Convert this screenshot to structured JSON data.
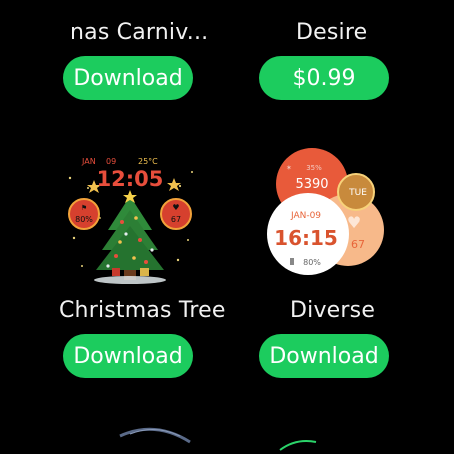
{
  "items": [
    {
      "title": "nas Carniv...",
      "button": "Download"
    },
    {
      "title": "Desire",
      "button": "$0.99"
    },
    {
      "title": "Christmas Tree",
      "button": "Download"
    },
    {
      "title": "Diverse",
      "button": "Download"
    }
  ],
  "xmas_face": {
    "month": "JAN",
    "day": "09",
    "temp": "25°C",
    "time": "12:05",
    "left_val": "80%",
    "right_val": "67"
  },
  "diverse_face": {
    "steps_pct": "35%",
    "steps": "5390",
    "weekday": "TUE",
    "date": "JAN-09",
    "time": "16:15",
    "battery": "80%",
    "heart": "67"
  },
  "colors": {
    "button": "#1ccc5e",
    "background": "#000000"
  }
}
